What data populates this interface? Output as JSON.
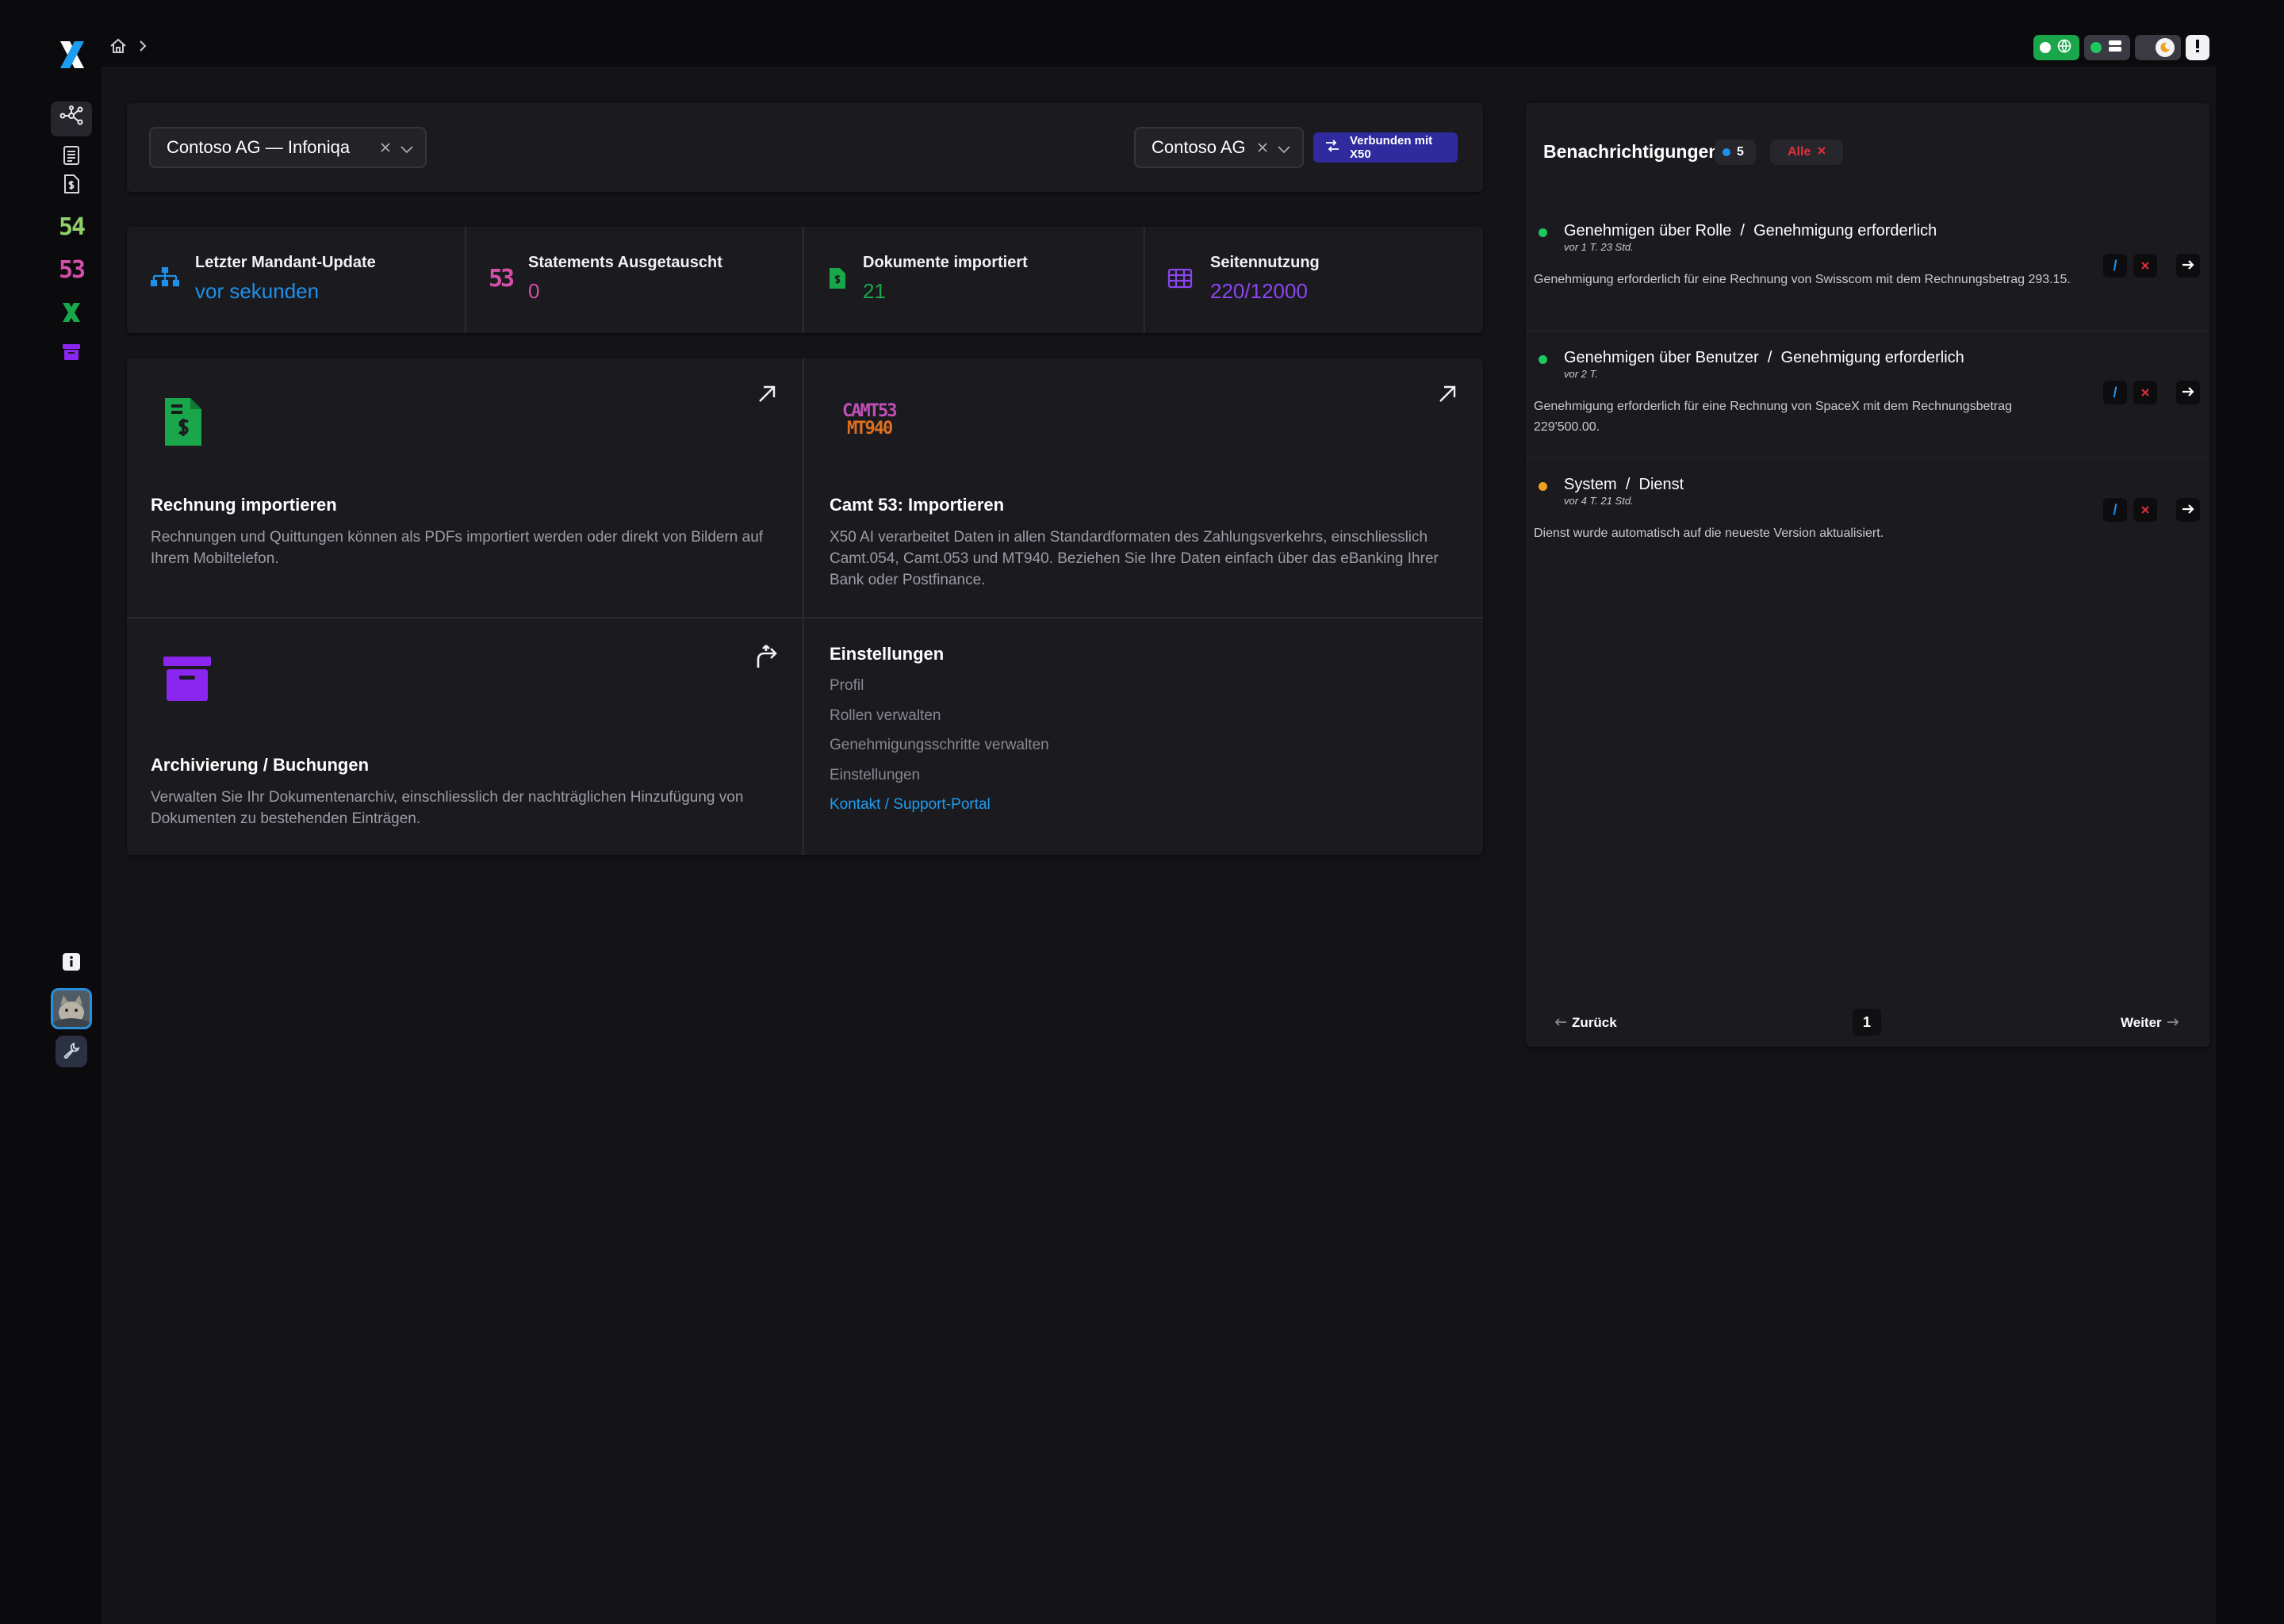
{
  "topbar": {
    "breadcrumb_home": "home-icon",
    "breadcrumb_sep": "chevron-right-icon",
    "toggles": [
      "status-online-toggle",
      "server-toggle",
      "theme-toggle",
      "alert-toggle"
    ]
  },
  "sidebar": {
    "logo": "x50-logo",
    "items": [
      {
        "name": "workflow",
        "icon": "network-icon"
      },
      {
        "name": "invoices",
        "icon": "receipt-icon"
      },
      {
        "name": "documents",
        "icon": "dollar-document-icon"
      },
      {
        "name": "camt54",
        "label": "54"
      },
      {
        "name": "camt53",
        "label": "53"
      },
      {
        "name": "x50",
        "label": "X"
      },
      {
        "name": "archive",
        "icon": "archive-icon"
      }
    ],
    "bottom": [
      "info-icon",
      "avatar",
      "wrench-icon"
    ]
  },
  "header": {
    "tenant_select": "Contoso AG — Infoniqa",
    "company_select": "Contoso AG",
    "connected_button": "Verbunden mit X50"
  },
  "stats": [
    {
      "label": "Letzter Mandant-Update",
      "value": "vor sekunden",
      "color": "#1e90e8",
      "icon": "sitemap-icon"
    },
    {
      "label": "Statements Ausgetauscht",
      "value": "0",
      "color": "#d44fa8",
      "icon": "camt53-icon"
    },
    {
      "label": "Dokumente importiert",
      "value": "21",
      "color": "#1aa64a",
      "icon": "document-dollar-icon"
    },
    {
      "label": "Seitennutzung",
      "value": "220/12000",
      "color": "#8b45f0",
      "icon": "table-icon"
    }
  ],
  "cards": {
    "invoice": {
      "title": "Rechnung importieren",
      "desc": "Rechnungen und Quittungen können als PDFs importiert werden oder direkt von Bildern auf Ihrem Mobiltelefon."
    },
    "camt": {
      "logo_top": "CAMT53",
      "logo_bottom": "MT940",
      "title": "Camt 53: Importieren",
      "desc": "X50 AI verarbeitet Daten in allen Standardformaten des Zahlungsverkehrs, einschliesslich Camt.054, Camt.053 und MT940. Beziehen Sie Ihre Daten einfach über das eBanking Ihrer Bank oder Postfinance."
    },
    "archive": {
      "title": "Archivierung / Buchungen",
      "desc": "Verwalten Sie Ihr Dokumentenarchiv, einschliesslich der nachträglichen Hinzufügung von Dokumenten zu bestehenden Einträgen."
    },
    "settings": {
      "title": "Einstellungen",
      "links": [
        "Profil",
        "Rollen verwalten",
        "Genehmigungsschritte verwalten",
        "Einstellungen",
        "Kontakt / Support-Portal"
      ]
    }
  },
  "notifications": {
    "title": "Benachrichtigungen",
    "count": "5",
    "filter": "Alle",
    "items": [
      {
        "source": "Genehmigen über Rolle",
        "type": "Genehmigung erforderlich",
        "time": "vor 1 T. 23 Std.",
        "body": "Genehmigung erforderlich für eine Rechnung von Swisscom mit dem Rechnungsbetrag 293.15.",
        "dot": "#1ec760"
      },
      {
        "source": "Genehmigen über Benutzer",
        "type": "Genehmigung erforderlich",
        "time": "vor 2 T.",
        "body": "Genehmigung erforderlich für eine Rechnung von SpaceX mit dem Rechnungsbetrag 229'500.00.",
        "dot": "#1ec760"
      },
      {
        "source": "System",
        "type": "Dienst",
        "time": "vor 4 T. 21 Std.",
        "body": "Dienst wurde automatisch auf die neueste Version aktualisiert.",
        "dot": "#f0a020"
      }
    ],
    "separator": "/",
    "pager": {
      "prev": "Zurück",
      "page": "1",
      "next": "Weiter"
    }
  }
}
